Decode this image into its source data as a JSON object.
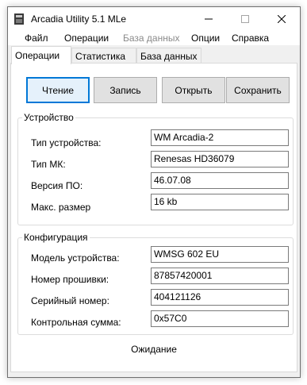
{
  "window": {
    "title": "Arcadia Utility 5.1 MLe"
  },
  "menu": [
    {
      "label": "Файл",
      "enabled": true
    },
    {
      "label": "Операции",
      "enabled": true
    },
    {
      "label": "База данных",
      "enabled": false
    },
    {
      "label": "Опции",
      "enabled": true
    },
    {
      "label": "Справка",
      "enabled": true
    }
  ],
  "tabs": [
    {
      "label": "Операции",
      "active": true
    },
    {
      "label": "Статистика",
      "active": false
    },
    {
      "label": "База данных",
      "active": false
    }
  ],
  "actions": {
    "read": "Чтение",
    "write": "Запись",
    "open": "Открыть",
    "save": "Сохранить"
  },
  "device": {
    "title": "Устройство",
    "rows": [
      {
        "label": "Тип устройства:",
        "value": "WM Arcadia-2"
      },
      {
        "label": "Тип МК:",
        "value": "Renesas HD36079"
      },
      {
        "label": "Версия ПО:",
        "value": "46.07.08"
      },
      {
        "label": "Макс. размер",
        "value": "16 kb"
      }
    ]
  },
  "config": {
    "title": "Конфигурация",
    "rows": [
      {
        "label": "Модель устройства:",
        "value": "WMSG 602 EU"
      },
      {
        "label": "Номер прошивки:",
        "value": "87857420001"
      },
      {
        "label": "Серийный номер:",
        "value": "404121126"
      },
      {
        "label": "Контрольная сумма:",
        "value": "0x57C0"
      }
    ]
  },
  "status": "Ожидание",
  "colors": {
    "accent": "#0078d7",
    "window_bg": "#f0f0f0",
    "button_bg": "#e1e1e1",
    "disabled_text": "#8a8a8a"
  }
}
